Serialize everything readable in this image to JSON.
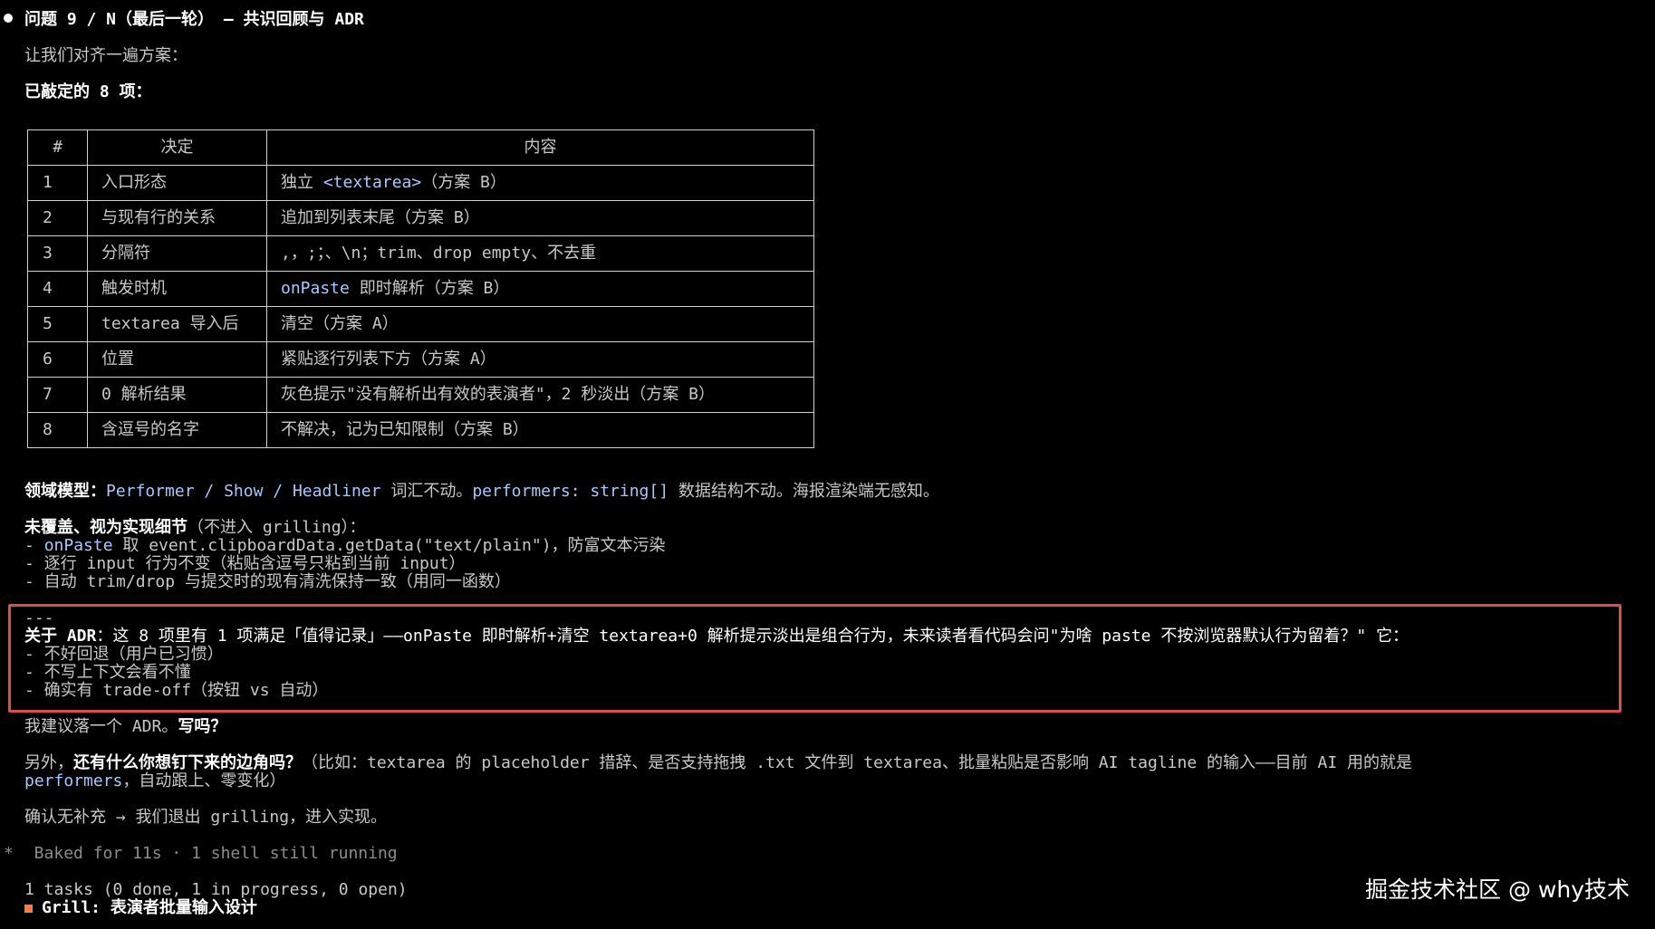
{
  "header": {
    "title": "问题 9 / N（最后一轮） — 共识回顾与 ADR"
  },
  "intro": "让我们对齐一遍方案：",
  "decided_heading": "已敲定的 8 项：",
  "table": {
    "headers": [
      "#",
      "决定",
      "内容"
    ],
    "rows": [
      {
        "n": "1",
        "decision": "入口形态",
        "content_pre": "独立 ",
        "content_code": "<textarea>",
        "content_post": "（方案 B）"
      },
      {
        "n": "2",
        "decision": "与现有行的关系",
        "content_pre": "追加到列表末尾（方案 B）",
        "content_code": "",
        "content_post": ""
      },
      {
        "n": "3",
        "decision": "分隔符",
        "content_pre": ",，;；、\\n；trim、drop empty、不去重",
        "content_code": "",
        "content_post": ""
      },
      {
        "n": "4",
        "decision": "触发时机",
        "content_pre": "",
        "content_code": "onPaste",
        "content_post": " 即时解析（方案 B）"
      },
      {
        "n": "5",
        "decision": "textarea 导入后",
        "content_pre": "清空（方案 A）",
        "content_code": "",
        "content_post": ""
      },
      {
        "n": "6",
        "decision": "位置",
        "content_pre": "紧贴逐行列表下方（方案 A）",
        "content_code": "",
        "content_post": ""
      },
      {
        "n": "7",
        "decision": "0 解析结果",
        "content_pre": "灰色提示\"没有解析出有效的表演者\"，2 秒淡出（方案 B）",
        "content_code": "",
        "content_post": ""
      },
      {
        "n": "8",
        "decision": "含逗号的名字",
        "content_pre": "不解决，记为已知限制（方案 B）",
        "content_code": "",
        "content_post": ""
      }
    ]
  },
  "domain_model": {
    "label": "领域模型：",
    "t1": "Performer",
    "s1": " / ",
    "t2": "Show",
    "s2": " / ",
    "t3": "Headliner",
    "mid": " 词汇不动。",
    "t4": "performers: string[]",
    "tail": " 数据结构不动。海报渲染端无感知。"
  },
  "uncovered": {
    "label": "未覆盖、视为实现细节",
    "paren": "（不进入 grilling）：",
    "item1_pre": "- ",
    "item1_code": "onPaste",
    "item1_mid": " 取 event.clipboardData.getData(\"text/plain\")，防富文本污染",
    "item2": "- 逐行 input 行为不变（粘贴含逗号只粘到当前 input）",
    "item3": "- 自动 trim/drop 与提交时的现有清洗保持一致（用同一函数）"
  },
  "adr": {
    "rule": "---",
    "label": "关于 ADR",
    "text": "：这 8 项里有 1 项满足「值得记录」——onPaste 即时解析+清空 textarea+0 解析提示淡出是组合行为，未来读者看代码会问\"为啥 paste 不按浏览器默认行为留着？\" 它：",
    "item1": "- 不好回退（用户已习惯）",
    "item2": "- 不写上下文会看不懂",
    "item3": "- 确实有 trade-off（按钮 vs 自动）"
  },
  "suggest": {
    "pre": "我建议落一个 ADR。",
    "bold": "写吗？"
  },
  "also": {
    "pre": "另外，",
    "bold": "还有什么你想钉下来的边角吗？",
    "rest": "（比如：textarea 的 placeholder 措辞、是否支持拖拽 .txt 文件到 textarea、批量粘贴是否影响 AI tagline 的输入——目前 AI 用的就是",
    "line2_code": "performers",
    "line2_rest": "，自动跟上、零变化）"
  },
  "confirm": "确认无补充 → 我们退出 grilling，进入实现。",
  "status": {
    "spinner": "*",
    "text": " Baked for 11s · 1 shell still running"
  },
  "tasks": {
    "summary": "1 tasks (0 done, 1 in progress, 0 open)",
    "item": "Grill: 表演者批量输入设计"
  },
  "watermark": "掘金技术社区 @ why技术",
  "colors": {
    "highlight": "#a6c8ff",
    "box_border": "#e04b4b",
    "task_marker": "#ff7a45"
  }
}
